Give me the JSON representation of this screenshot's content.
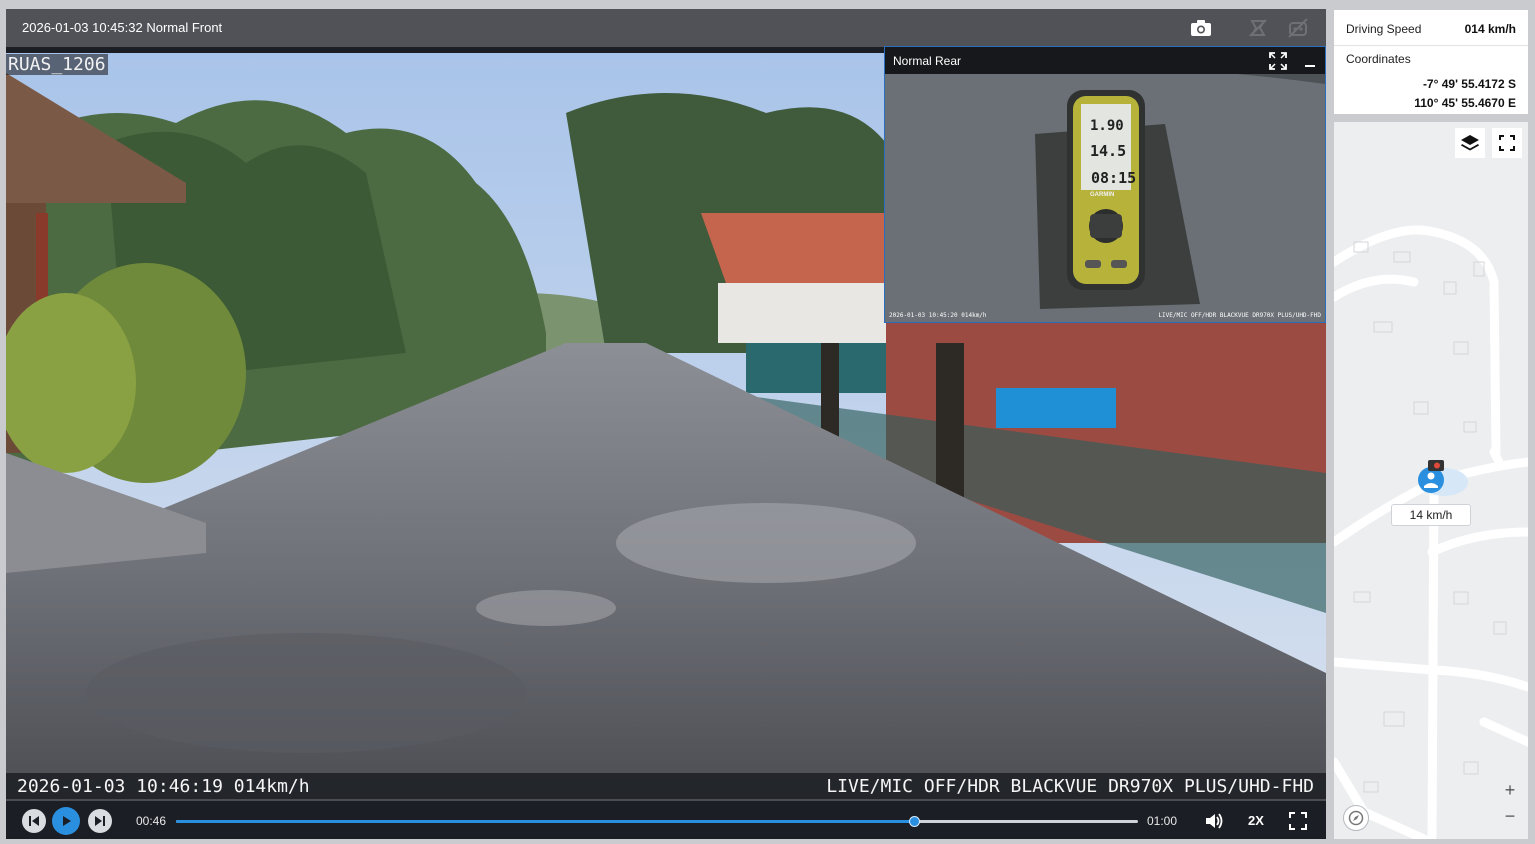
{
  "player": {
    "title": "2026-01-03 10:45:32 Normal Front",
    "camera_name": "RUAS_1206",
    "osd_left": "2026-01-03 10:46:19 014km/h",
    "osd_right": "LIVE/MIC OFF/HDR BLACKVUE DR970X PLUS/UHD-FHD",
    "header_icons": [
      "camera-icon",
      "no-smoking-icon",
      "robot-icon"
    ]
  },
  "rear": {
    "title": "Normal Rear",
    "screen_lines": [
      "1.90",
      "14.5",
      "08:15"
    ],
    "device_brand": "GARMIN",
    "osd_left": "2026-01-03 10:45:20 014km/h",
    "osd_right": "LIVE/MIC OFF/HDR BLACKVUE DR970X PLUS/UHD-FHD"
  },
  "controls": {
    "time_current": "00:46",
    "time_total": "01:00",
    "progress": 0.767,
    "playback_rate": "2X"
  },
  "info": {
    "speed_label": "Driving Speed",
    "speed_value": "014 km/h",
    "coords_label": "Coordinates",
    "lat": "-7° 49' 55.4172 S",
    "lon": "110° 45' 55.4670 E"
  },
  "map": {
    "speed_tag": "14 km/h",
    "zoom_in": "+",
    "zoom_out": "−"
  },
  "colors": {
    "accent": "#2b8fe0",
    "player_bg": "#1b1e24",
    "header_bg": "#505257",
    "page_bg": "#c9cbce"
  }
}
